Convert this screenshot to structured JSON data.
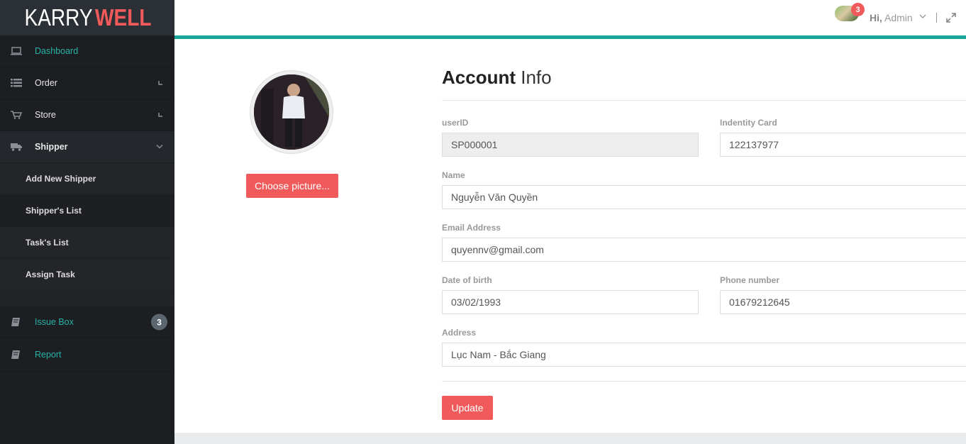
{
  "logo": {
    "part1": "KARRY",
    "part2": "WELL"
  },
  "sidebar": {
    "items": [
      {
        "label": "Dashboard",
        "icon": "laptop-icon"
      },
      {
        "label": "Order",
        "icon": "list-icon"
      },
      {
        "label": "Store",
        "icon": "cart-icon"
      },
      {
        "label": "Shipper",
        "icon": "truck-icon"
      }
    ],
    "submenu": [
      {
        "label": "Add New Shipper"
      },
      {
        "label": "Shipper's List"
      },
      {
        "label": "Task's List"
      },
      {
        "label": "Assign Task"
      }
    ],
    "lower_items": [
      {
        "label": "Issue Box",
        "icon": "book-icon",
        "badge": "3"
      },
      {
        "label": "Report",
        "icon": "book-icon"
      }
    ]
  },
  "header": {
    "notification_count": "3",
    "greeting": "Hi,",
    "user_name": "Admin"
  },
  "profile": {
    "choose_button": "Choose picture..."
  },
  "form": {
    "title_bold": "Account",
    "title_light": "Info",
    "user_id_label": "userID",
    "user_id_value": "SP000001",
    "identity_label": "Indentity Card",
    "identity_value": "122137977",
    "name_label": "Name",
    "name_value": "Nguyễn Văn Quyền",
    "email_label": "Email Address",
    "email_value": "quyennv@gmail.com",
    "dob_label": "Date of birth",
    "dob_value": "03/02/1993",
    "phone_label": "Phone number",
    "phone_value": "01679212645",
    "address_label": "Address",
    "address_value": "Lục Nam - Bắc Giang",
    "update_button": "Update"
  },
  "colors": {
    "accent_teal": "#1aa79b",
    "button_red": "#f05a5b",
    "sidebar_bg": "#1c1e22"
  }
}
